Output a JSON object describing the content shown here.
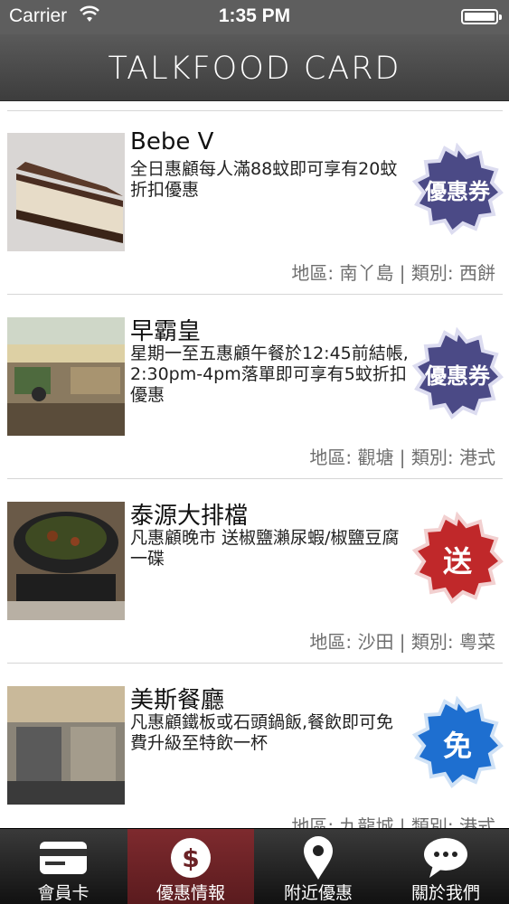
{
  "status": {
    "carrier": "Carrier",
    "time": "1:35 PM"
  },
  "header": {
    "title": "TALKFOOD CARD"
  },
  "items": [
    {
      "name": "Bebe V",
      "desc": "全日惠顧每人滿88蚊即可享有20蚊折扣優惠",
      "meta": "地區: 南丫島 | 類別: 西餅",
      "badge": "優惠券",
      "badge_color": "#4b4a86"
    },
    {
      "name": "早霸皇",
      "desc": "星期一至五惠顧午餐於12:45前結帳,2:30pm-4pm落單即可享有5蚊折扣優惠",
      "meta": "地區: 觀塘 | 類別: 港式",
      "badge": "優惠券",
      "badge_color": "#4b4a86"
    },
    {
      "name": "泰源大排檔",
      "desc": "凡惠顧晚市 送椒鹽瀨尿蝦/椒鹽豆腐 一碟",
      "meta": "地區: 沙田 | 類別: 粵菜",
      "badge": "送",
      "badge_color": "#c0282a"
    },
    {
      "name": "美斯餐廳",
      "desc": "凡惠顧鐵板或石頭鍋飯,餐飲即可免費升級至特飲一杯",
      "meta": "地區: 九龍城 | 類別: 港式",
      "badge": "免",
      "badge_color": "#1e6fd0"
    }
  ],
  "tabs": [
    {
      "label": "會員卡",
      "icon": "card-icon"
    },
    {
      "label": "優惠情報",
      "icon": "dollar-icon"
    },
    {
      "label": "附近優惠",
      "icon": "location-pin-icon"
    },
    {
      "label": "關於我們",
      "icon": "chat-bubble-icon"
    }
  ],
  "colors": {
    "nav": "#4a4a4a",
    "active_tab": "#6b2226",
    "meta_text": "#6e6e6e"
  }
}
